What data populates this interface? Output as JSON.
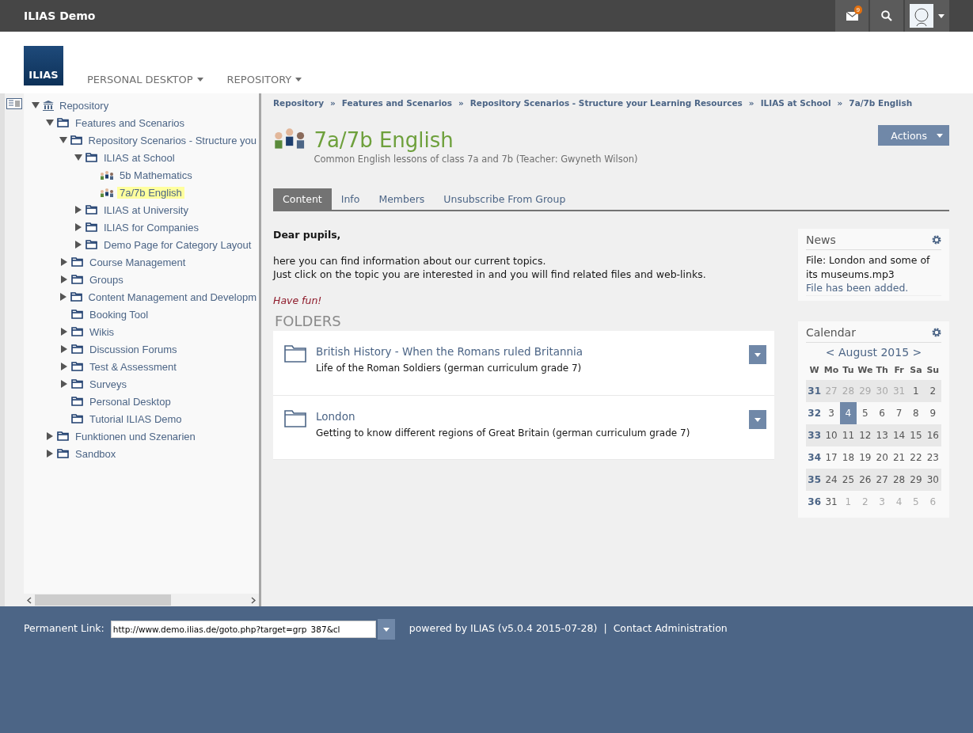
{
  "topbar": {
    "title": "ILIAS Demo",
    "mail_count": "9"
  },
  "header": {
    "logo": "ILIAS",
    "menu": [
      {
        "label": "PERSONAL DESKTOP"
      },
      {
        "label": "REPOSITORY"
      }
    ]
  },
  "tree": [
    {
      "label": "Repository",
      "kind": "root",
      "expanded": true,
      "selected": false,
      "children": [
        {
          "label": "Features and Scenarios",
          "kind": "folder",
          "expanded": true,
          "selected": false,
          "children": [
            {
              "label": "Repository Scenarios - Structure you",
              "kind": "folder",
              "expanded": true,
              "selected": false,
              "children": [
                {
                  "label": "ILIAS at School",
                  "kind": "folder",
                  "expanded": true,
                  "selected": false,
                  "children": [
                    {
                      "label": "5b Mathematics",
                      "kind": "group",
                      "selected": false
                    },
                    {
                      "label": "7a/7b English",
                      "kind": "group",
                      "selected": true
                    }
                  ]
                },
                {
                  "label": "ILIAS at University",
                  "kind": "folder",
                  "expanded": false,
                  "selected": false
                },
                {
                  "label": "ILIAS for Companies",
                  "kind": "folder",
                  "expanded": false,
                  "selected": false
                },
                {
                  "label": "Demo Page for Category Layout",
                  "kind": "folder",
                  "expanded": false,
                  "selected": false
                }
              ]
            },
            {
              "label": "Course Management",
              "kind": "folder",
              "expanded": false,
              "selected": false
            },
            {
              "label": "Groups",
              "kind": "folder",
              "expanded": false,
              "selected": false
            },
            {
              "label": "Content Management and Developm",
              "kind": "folder",
              "expanded": false,
              "selected": false
            },
            {
              "label": "Booking Tool",
              "kind": "folder",
              "selected": false
            },
            {
              "label": "Wikis",
              "kind": "folder",
              "expanded": false,
              "selected": false
            },
            {
              "label": "Discussion Forums",
              "kind": "folder",
              "expanded": false,
              "selected": false
            },
            {
              "label": "Test & Assessment",
              "kind": "folder",
              "expanded": false,
              "selected": false
            },
            {
              "label": "Surveys",
              "kind": "folder",
              "expanded": false,
              "selected": false
            },
            {
              "label": "Personal Desktop",
              "kind": "folder",
              "selected": false
            },
            {
              "label": "Tutorial ILIAS Demo",
              "kind": "folder",
              "selected": false
            }
          ]
        },
        {
          "label": "Funktionen und Szenarien",
          "kind": "folder",
          "expanded": false,
          "selected": false
        },
        {
          "label": "Sandbox",
          "kind": "folder",
          "expanded": false,
          "selected": false
        }
      ]
    }
  ],
  "breadcrumb": [
    "Repository",
    "Features and Scenarios",
    "Repository Scenarios - Structure your Learning Resources",
    "ILIAS at School",
    "7a/7b English"
  ],
  "breadcrumb_separator": "»",
  "page": {
    "title": "7a/7b English",
    "description": "Common English lessons of class 7a and 7b (Teacher: Gwyneth Wilson)",
    "actions": "Actions"
  },
  "tabs": [
    {
      "label": "Content",
      "selected": true
    },
    {
      "label": "Info",
      "selected": false
    },
    {
      "label": "Members",
      "selected": false
    },
    {
      "label": "Unsubscribe From Group",
      "selected": false
    }
  ],
  "intro": {
    "greeting": "Dear pupils,",
    "lines": [
      "here you can find information about our current topics.",
      "Just click on the topic you are interested in and you will find related files and web-links."
    ],
    "closing": "Have fun!"
  },
  "folders": {
    "heading": "FOLDERS",
    "items": [
      {
        "title": "British History - When the Romans ruled Britannia",
        "description": "Life of the Roman Soldiers (german curriculum grade 7)"
      },
      {
        "title": "London",
        "description": "Getting to know different regions of Great Britain (german curriculum grade 7)"
      }
    ]
  },
  "news": {
    "title": "News",
    "item": "File: London and some of its museums.mp3",
    "note": "File has been added."
  },
  "calendar": {
    "title": "Calendar",
    "month": "< August 2015 >",
    "headers": [
      "W",
      "Mo",
      "Tu",
      "We",
      "Th",
      "Fr",
      "Sa",
      "Su"
    ],
    "weeks": [
      {
        "week": "31",
        "days": [
          {
            "d": "27",
            "muted": true,
            "selected": false
          },
          {
            "d": "28",
            "muted": true,
            "selected": false
          },
          {
            "d": "29",
            "muted": true,
            "selected": false
          },
          {
            "d": "30",
            "muted": true,
            "selected": false
          },
          {
            "d": "31",
            "muted": true,
            "selected": false
          },
          {
            "d": "1",
            "muted": false,
            "selected": false
          },
          {
            "d": "2",
            "muted": false,
            "selected": false
          }
        ]
      },
      {
        "week": "32",
        "days": [
          {
            "d": "3",
            "muted": false,
            "selected": false
          },
          {
            "d": "4",
            "muted": false,
            "selected": true
          },
          {
            "d": "5",
            "muted": false,
            "selected": false
          },
          {
            "d": "6",
            "muted": false,
            "selected": false
          },
          {
            "d": "7",
            "muted": false,
            "selected": false
          },
          {
            "d": "8",
            "muted": false,
            "selected": false
          },
          {
            "d": "9",
            "muted": false,
            "selected": false
          }
        ]
      },
      {
        "week": "33",
        "days": [
          {
            "d": "10",
            "muted": false,
            "selected": false
          },
          {
            "d": "11",
            "muted": false,
            "selected": false
          },
          {
            "d": "12",
            "muted": false,
            "selected": false
          },
          {
            "d": "13",
            "muted": false,
            "selected": false
          },
          {
            "d": "14",
            "muted": false,
            "selected": false
          },
          {
            "d": "15",
            "muted": false,
            "selected": false
          },
          {
            "d": "16",
            "muted": false,
            "selected": false
          }
        ]
      },
      {
        "week": "34",
        "days": [
          {
            "d": "17",
            "muted": false,
            "selected": false
          },
          {
            "d": "18",
            "muted": false,
            "selected": false
          },
          {
            "d": "19",
            "muted": false,
            "selected": false
          },
          {
            "d": "20",
            "muted": false,
            "selected": false
          },
          {
            "d": "21",
            "muted": false,
            "selected": false
          },
          {
            "d": "22",
            "muted": false,
            "selected": false
          },
          {
            "d": "23",
            "muted": false,
            "selected": false
          }
        ]
      },
      {
        "week": "35",
        "days": [
          {
            "d": "24",
            "muted": false,
            "selected": false
          },
          {
            "d": "25",
            "muted": false,
            "selected": false
          },
          {
            "d": "26",
            "muted": false,
            "selected": false
          },
          {
            "d": "27",
            "muted": false,
            "selected": false
          },
          {
            "d": "28",
            "muted": false,
            "selected": false
          },
          {
            "d": "29",
            "muted": false,
            "selected": false
          },
          {
            "d": "30",
            "muted": false,
            "selected": false
          }
        ]
      },
      {
        "week": "36",
        "days": [
          {
            "d": "31",
            "muted": false,
            "selected": false
          },
          {
            "d": "1",
            "muted": true,
            "selected": false
          },
          {
            "d": "2",
            "muted": true,
            "selected": false
          },
          {
            "d": "3",
            "muted": true,
            "selected": false
          },
          {
            "d": "4",
            "muted": true,
            "selected": false
          },
          {
            "d": "5",
            "muted": true,
            "selected": false
          },
          {
            "d": "6",
            "muted": true,
            "selected": false
          }
        ]
      }
    ]
  },
  "footer": {
    "link_label": "Permanent Link:",
    "link_value": "http://www.demo.ilias.de/goto.php?target=grp_387&cl",
    "powered": "powered by ILIAS (v5.0.4 2015-07-28)",
    "separator": "|",
    "contact": "Contact Administration"
  }
}
